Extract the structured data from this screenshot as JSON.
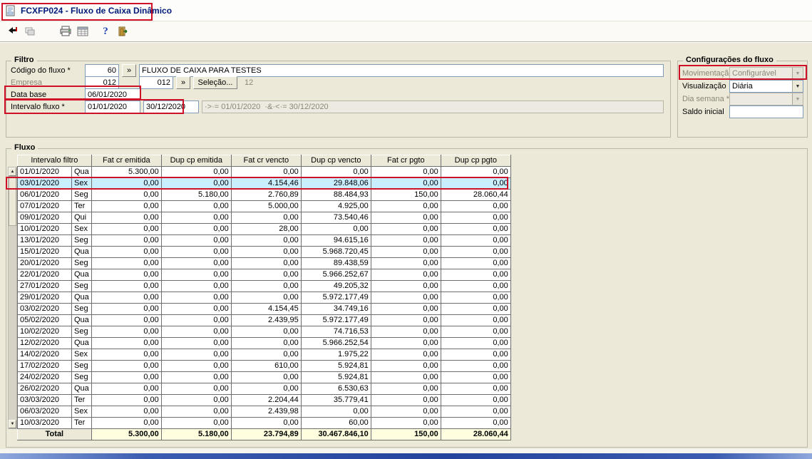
{
  "window": {
    "title": "FCXFP024 - Fluxo de Caixa Dinâmico"
  },
  "toolbar": {
    "icons": [
      {
        "name": "return-arrow-icon"
      },
      {
        "name": "windows-cascade-icon"
      },
      {
        "name": "printer-icon"
      },
      {
        "name": "spreadsheet-icon"
      },
      {
        "name": "help-icon",
        "glyph": "?"
      },
      {
        "name": "exit-door-icon"
      }
    ]
  },
  "filtro": {
    "title": "Filtro",
    "codigo_fluxo_label": "Código do fluxo *",
    "codigo_fluxo_value": "60",
    "lookup_button": "»",
    "codigo_fluxo_desc": "FLUXO DE CAIXA PARA TESTES",
    "empresa_label": "Empresa",
    "empresa_value": "012",
    "empresa_value2": "012",
    "selecao_button": "Seleção...",
    "empresa_extra": "12",
    "data_base_label": "Data base",
    "data_base_value": "06/01/2020",
    "intervalo_label": "Intervalo fluxo *",
    "intervalo_from": "01/01/2020",
    "intervalo_to": "30/12/2020",
    "intervalo_hint": "·>·= 01/01/2020  ·&·<·= 30/12/2020"
  },
  "config": {
    "title": "Configurações do fluxo",
    "movimentacao_label": "Movimentação",
    "movimentacao_value": "Configurável",
    "visualizacao_label": "Visualização",
    "visualizacao_value": "Diária",
    "dia_semana_label": "Dia semana *",
    "dia_semana_value": "",
    "saldo_inicial_label": "Saldo inicial",
    "saldo_inicial_value": ""
  },
  "fluxo": {
    "title": "Fluxo",
    "columns": [
      "Intervalo filtro",
      "Fat cr emitida",
      "Dup cp emitida",
      "Fat cr vencto",
      "Dup cp vencto",
      "Fat cr pgto",
      "Dup cp pgto"
    ],
    "rows": [
      {
        "date": "01/01/2020",
        "day": "Qua",
        "values": [
          "5.300,00",
          "0,00",
          "0,00",
          "0,00",
          "0,00",
          "0,00"
        ],
        "highlight": false
      },
      {
        "date": "03/01/2020",
        "day": "Sex",
        "values": [
          "0,00",
          "0,00",
          "4.154,46",
          "29.848,06",
          "0,00",
          "0,00"
        ],
        "highlight": true
      },
      {
        "date": "06/01/2020",
        "day": "Seg",
        "values": [
          "0,00",
          "5.180,00",
          "2.760,89",
          "88.484,93",
          "150,00",
          "28.060,44"
        ],
        "highlight": false
      },
      {
        "date": "07/01/2020",
        "day": "Ter",
        "values": [
          "0,00",
          "0,00",
          "5.000,00",
          "4.925,00",
          "0,00",
          "0,00"
        ],
        "highlight": false
      },
      {
        "date": "09/01/2020",
        "day": "Qui",
        "values": [
          "0,00",
          "0,00",
          "0,00",
          "73.540,46",
          "0,00",
          "0,00"
        ],
        "highlight": false
      },
      {
        "date": "10/01/2020",
        "day": "Sex",
        "values": [
          "0,00",
          "0,00",
          "28,00",
          "0,00",
          "0,00",
          "0,00"
        ],
        "highlight": false
      },
      {
        "date": "13/01/2020",
        "day": "Seg",
        "values": [
          "0,00",
          "0,00",
          "0,00",
          "94.615,16",
          "0,00",
          "0,00"
        ],
        "highlight": false
      },
      {
        "date": "15/01/2020",
        "day": "Qua",
        "values": [
          "0,00",
          "0,00",
          "0,00",
          "5.968.720,45",
          "0,00",
          "0,00"
        ],
        "highlight": false
      },
      {
        "date": "20/01/2020",
        "day": "Seg",
        "values": [
          "0,00",
          "0,00",
          "0,00",
          "89.438,59",
          "0,00",
          "0,00"
        ],
        "highlight": false
      },
      {
        "date": "22/01/2020",
        "day": "Qua",
        "values": [
          "0,00",
          "0,00",
          "0,00",
          "5.966.252,67",
          "0,00",
          "0,00"
        ],
        "highlight": false
      },
      {
        "date": "27/01/2020",
        "day": "Seg",
        "values": [
          "0,00",
          "0,00",
          "0,00",
          "49.205,32",
          "0,00",
          "0,00"
        ],
        "highlight": false
      },
      {
        "date": "29/01/2020",
        "day": "Qua",
        "values": [
          "0,00",
          "0,00",
          "0,00",
          "5.972.177,49",
          "0,00",
          "0,00"
        ],
        "highlight": false
      },
      {
        "date": "03/02/2020",
        "day": "Seg",
        "values": [
          "0,00",
          "0,00",
          "4.154,45",
          "34.749,16",
          "0,00",
          "0,00"
        ],
        "highlight": false
      },
      {
        "date": "05/02/2020",
        "day": "Qua",
        "values": [
          "0,00",
          "0,00",
          "2.439,95",
          "5.972.177,49",
          "0,00",
          "0,00"
        ],
        "highlight": false
      },
      {
        "date": "10/02/2020",
        "day": "Seg",
        "values": [
          "0,00",
          "0,00",
          "0,00",
          "74.716,53",
          "0,00",
          "0,00"
        ],
        "highlight": false
      },
      {
        "date": "12/02/2020",
        "day": "Qua",
        "values": [
          "0,00",
          "0,00",
          "0,00",
          "5.966.252,54",
          "0,00",
          "0,00"
        ],
        "highlight": false
      },
      {
        "date": "14/02/2020",
        "day": "Sex",
        "values": [
          "0,00",
          "0,00",
          "0,00",
          "1.975,22",
          "0,00",
          "0,00"
        ],
        "highlight": false
      },
      {
        "date": "17/02/2020",
        "day": "Seg",
        "values": [
          "0,00",
          "0,00",
          "610,00",
          "5.924,81",
          "0,00",
          "0,00"
        ],
        "highlight": false
      },
      {
        "date": "24/02/2020",
        "day": "Seg",
        "values": [
          "0,00",
          "0,00",
          "0,00",
          "5.924,81",
          "0,00",
          "0,00"
        ],
        "highlight": false
      },
      {
        "date": "26/02/2020",
        "day": "Qua",
        "values": [
          "0,00",
          "0,00",
          "0,00",
          "6.530,63",
          "0,00",
          "0,00"
        ],
        "highlight": false
      },
      {
        "date": "03/03/2020",
        "day": "Ter",
        "values": [
          "0,00",
          "0,00",
          "2.204,44",
          "35.779,41",
          "0,00",
          "0,00"
        ],
        "highlight": false
      },
      {
        "date": "06/03/2020",
        "day": "Sex",
        "values": [
          "0,00",
          "0,00",
          "2.439,98",
          "0,00",
          "0,00",
          "0,00"
        ],
        "highlight": false
      },
      {
        "date": "10/03/2020",
        "day": "Ter",
        "values": [
          "0,00",
          "0,00",
          "0,00",
          "60,00",
          "0,00",
          "0,00"
        ],
        "highlight": false
      }
    ],
    "total_label": "Total",
    "total_values": [
      "5.300,00",
      "5.180,00",
      "23.794,89",
      "30.467.846,10",
      "150,00",
      "28.060,44"
    ]
  },
  "colors": {
    "highlight_row": "#C9EEFF",
    "total_cell": "#FFFFDF",
    "annotation": "#CE1126",
    "title_text": "#001A7A",
    "panel": "#ECE9D8"
  }
}
